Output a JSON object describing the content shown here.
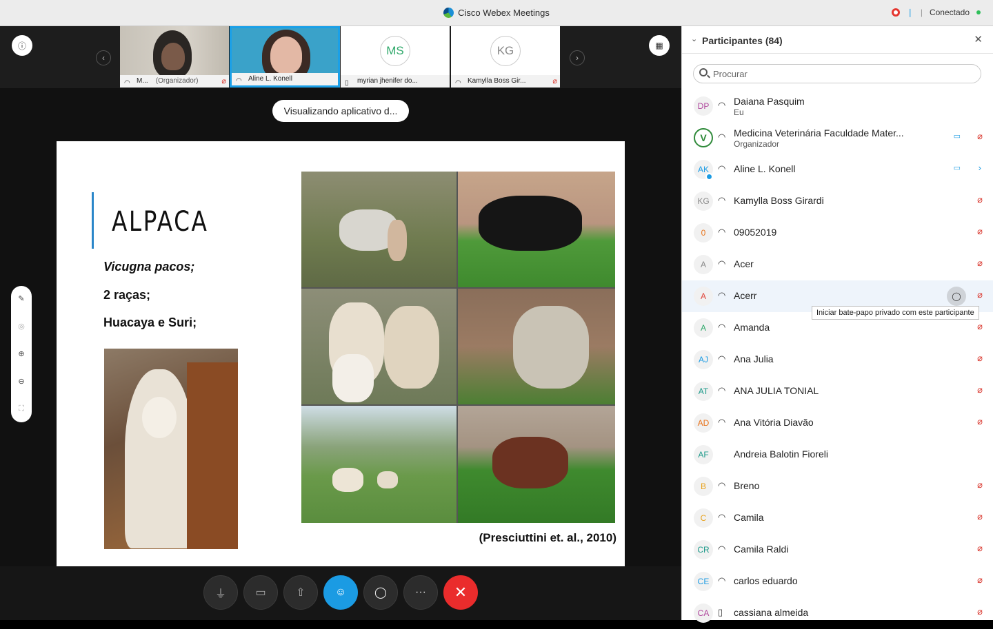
{
  "window": {
    "title": "Cisco Webex Meetings",
    "status": "Conectado"
  },
  "filmstrip": {
    "tiles": [
      {
        "name": "M...",
        "role": "(Organizador)"
      },
      {
        "name": "Aline L. Konell"
      },
      {
        "name": "myrian jhenifer do...",
        "initials": "MS",
        "initials_color": "#2fa86a"
      },
      {
        "name": "Kamylla Boss Gir...",
        "initials": "KG",
        "initials_color": "#8a8a8a"
      }
    ]
  },
  "viewing_label": "Visualizando aplicativo d...",
  "slide": {
    "title": "ALPACA",
    "line1": "Vicugna pacos;",
    "line2": "2 raças;",
    "line3": "Huacaya e Suri;",
    "citation": "(Presciuttini et. al., 2010)"
  },
  "controls": {
    "mute": "mute-microphone",
    "video": "stop-video",
    "share": "share-content",
    "participants": "participants",
    "chat": "chat",
    "more": "···",
    "leave": "✕"
  },
  "panel": {
    "title": "Participantes (84)",
    "search_placeholder": "Procurar",
    "tooltip": "Iniciar bate-papo privado com este participante",
    "participants": [
      {
        "initials": "DP",
        "color": "#b0479d",
        "name": "Daiana Pasquim",
        "sub": "Eu",
        "muted": false
      },
      {
        "initials": "V",
        "color": "#2f8a3a",
        "name": "Medicina Veterinária Faculdade Mater...",
        "sub": "Organizador",
        "muted": true,
        "video": true,
        "logo": true
      },
      {
        "initials": "AK",
        "color": "#1b9be3",
        "name": "Aline L. Konell",
        "muted": false,
        "video": true,
        "expand": true
      },
      {
        "initials": "KG",
        "color": "#8a8a8a",
        "name": " Kamylla Boss Girardi",
        "muted": true
      },
      {
        "initials": "0",
        "color": "#e8741c",
        "name": "09052019",
        "muted": true
      },
      {
        "initials": "A",
        "color": "#8a8a8a",
        "name": "Acer",
        "muted": true
      },
      {
        "initials": "A",
        "color": "#e0453a",
        "name": "Acerr",
        "muted": true,
        "hover": true
      },
      {
        "initials": "A",
        "color": "#2fa86a",
        "name": "Amanda",
        "muted": true
      },
      {
        "initials": "AJ",
        "color": "#1b9be3",
        "name": "Ana Julia",
        "muted": true
      },
      {
        "initials": "AT",
        "color": "#1e9a8a",
        "name": "ANA JULIA TONIAL",
        "muted": true
      },
      {
        "initials": "AD",
        "color": "#e8741c",
        "name": "Ana Vitória Diavão",
        "muted": true
      },
      {
        "initials": "AF",
        "color": "#1e9a8a",
        "name": "Andreia Balotin Fioreli",
        "muted": false,
        "nohead": true
      },
      {
        "initials": "B",
        "color": "#e8a21c",
        "name": "Breno",
        "muted": true
      },
      {
        "initials": "C",
        "color": "#e8a21c",
        "name": "Camila",
        "muted": true
      },
      {
        "initials": "CR",
        "color": "#1e9a8a",
        "name": "Camila Raldi",
        "muted": true
      },
      {
        "initials": "CE",
        "color": "#1b9be3",
        "name": "carlos eduardo",
        "muted": true
      },
      {
        "initials": "CA",
        "color": "#b0479d",
        "name": "cassiana almeida",
        "muted": true,
        "phone": true
      }
    ]
  }
}
